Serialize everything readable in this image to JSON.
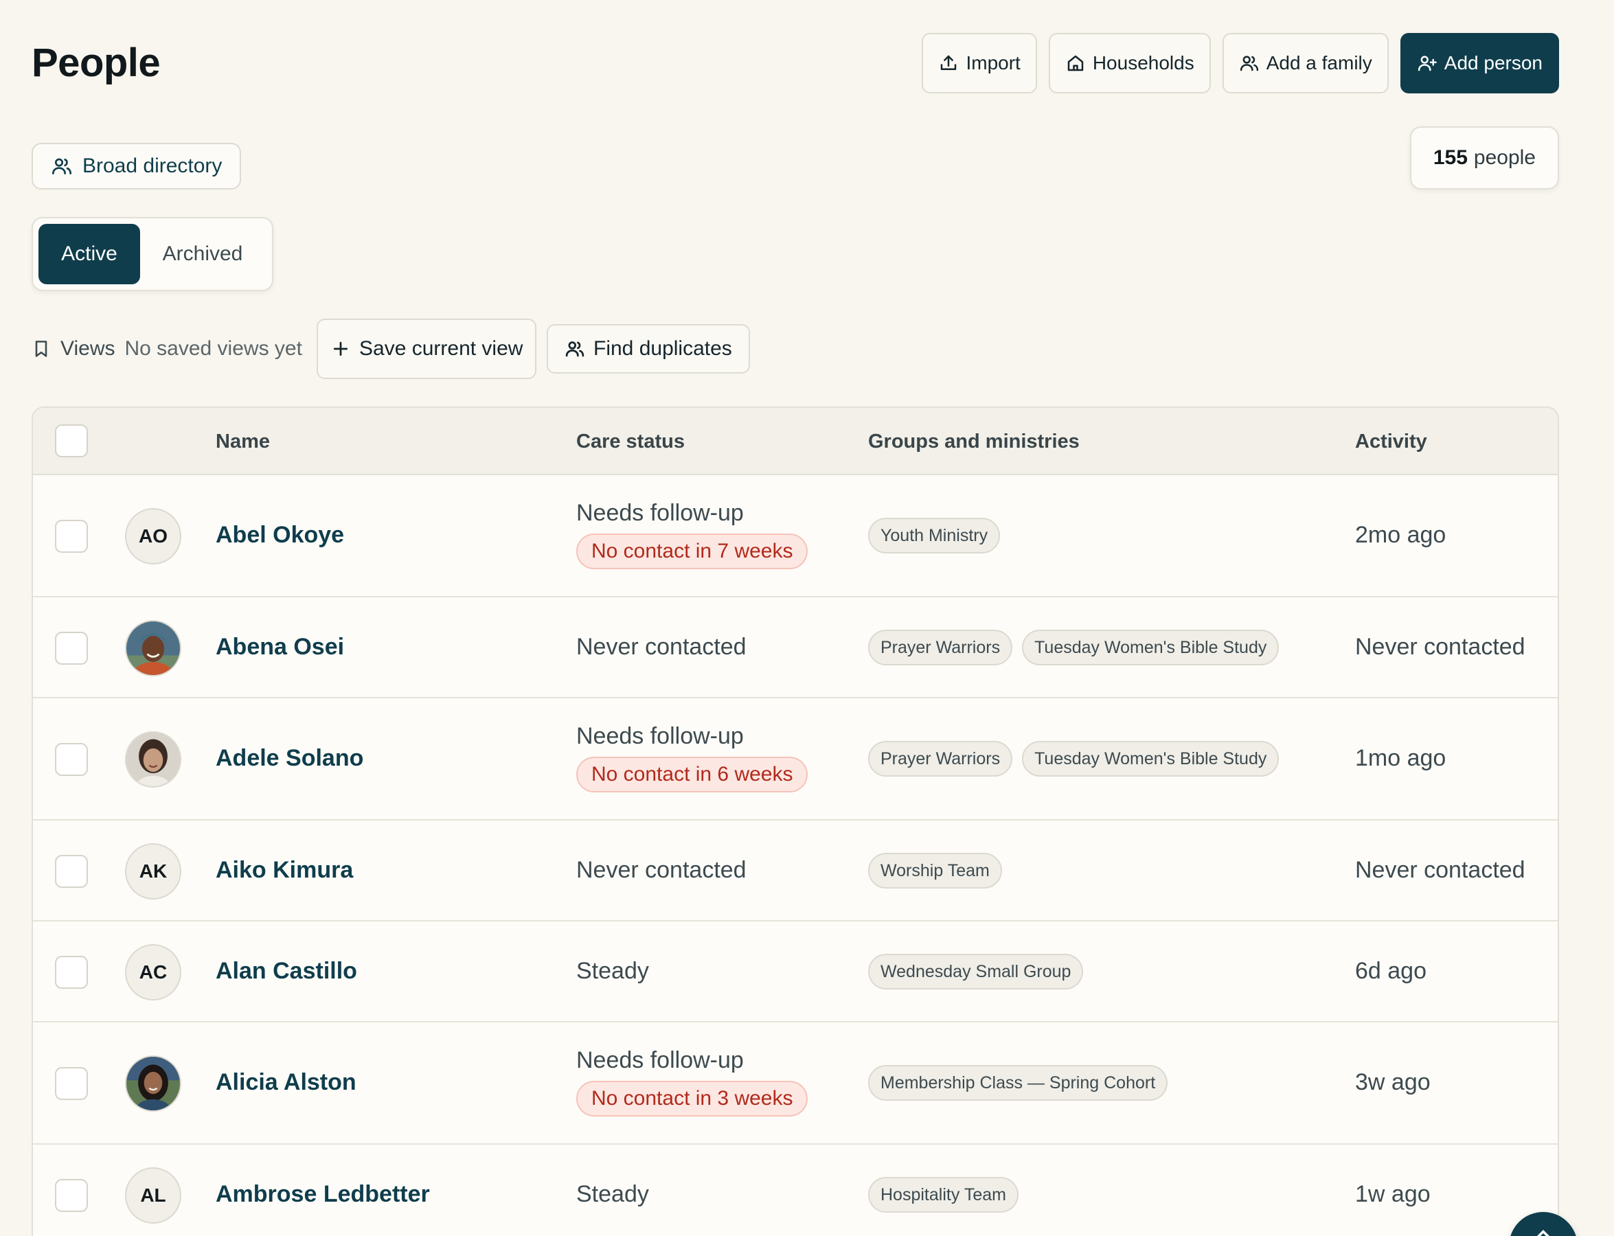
{
  "header": {
    "title": "People",
    "actions": {
      "import": "Import",
      "households": "Households",
      "add_family": "Add a family",
      "add_person": "Add person"
    }
  },
  "directory": {
    "label": "Broad directory"
  },
  "count": {
    "value": "155",
    "unit": "people"
  },
  "status_toggle": {
    "active": "Active",
    "archived": "Archived",
    "selected": "Active"
  },
  "views": {
    "label": "Views",
    "empty_text": "No saved views yet",
    "save_label": "Save current view",
    "duplicates_label": "Find duplicates"
  },
  "table": {
    "columns": [
      "Name",
      "Care status",
      "Groups and ministries",
      "Activity"
    ],
    "rows": [
      {
        "initials": "AO",
        "photo": false,
        "name": "Abel Okoye",
        "care_status": "Needs follow-up",
        "flag": "No contact in 7 weeks",
        "groups": [
          "Youth Ministry"
        ],
        "activity": "2mo ago"
      },
      {
        "initials": "",
        "photo": true,
        "name": "Abena Osei",
        "care_status": "Never contacted",
        "flag": "",
        "groups": [
          "Prayer Warriors",
          "Tuesday Women's Bible Study"
        ],
        "activity": "Never contacted"
      },
      {
        "initials": "",
        "photo": true,
        "name": "Adele Solano",
        "care_status": "Needs follow-up",
        "flag": "No contact in 6 weeks",
        "groups": [
          "Prayer Warriors",
          "Tuesday Women's Bible Study"
        ],
        "activity": "1mo ago"
      },
      {
        "initials": "AK",
        "photo": false,
        "name": "Aiko Kimura",
        "care_status": "Never contacted",
        "flag": "",
        "groups": [
          "Worship Team"
        ],
        "activity": "Never contacted"
      },
      {
        "initials": "AC",
        "photo": false,
        "name": "Alan Castillo",
        "care_status": "Steady",
        "flag": "",
        "groups": [
          "Wednesday Small Group"
        ],
        "activity": "6d ago"
      },
      {
        "initials": "",
        "photo": true,
        "name": "Alicia Alston",
        "care_status": "Needs follow-up",
        "flag": "No contact in 3 weeks",
        "groups": [
          "Membership Class — Spring Cohort"
        ],
        "activity": "3w ago"
      },
      {
        "initials": "AL",
        "photo": false,
        "name": "Ambrose Ledbetter",
        "care_status": "Steady",
        "flag": "",
        "groups": [
          "Hospitality Team"
        ],
        "activity": "1w ago"
      }
    ]
  },
  "colors": {
    "accent": "#0f3d4c",
    "background": "#f8f6ef",
    "alert_text": "#b12a1c",
    "alert_background": "#fde7e2"
  }
}
